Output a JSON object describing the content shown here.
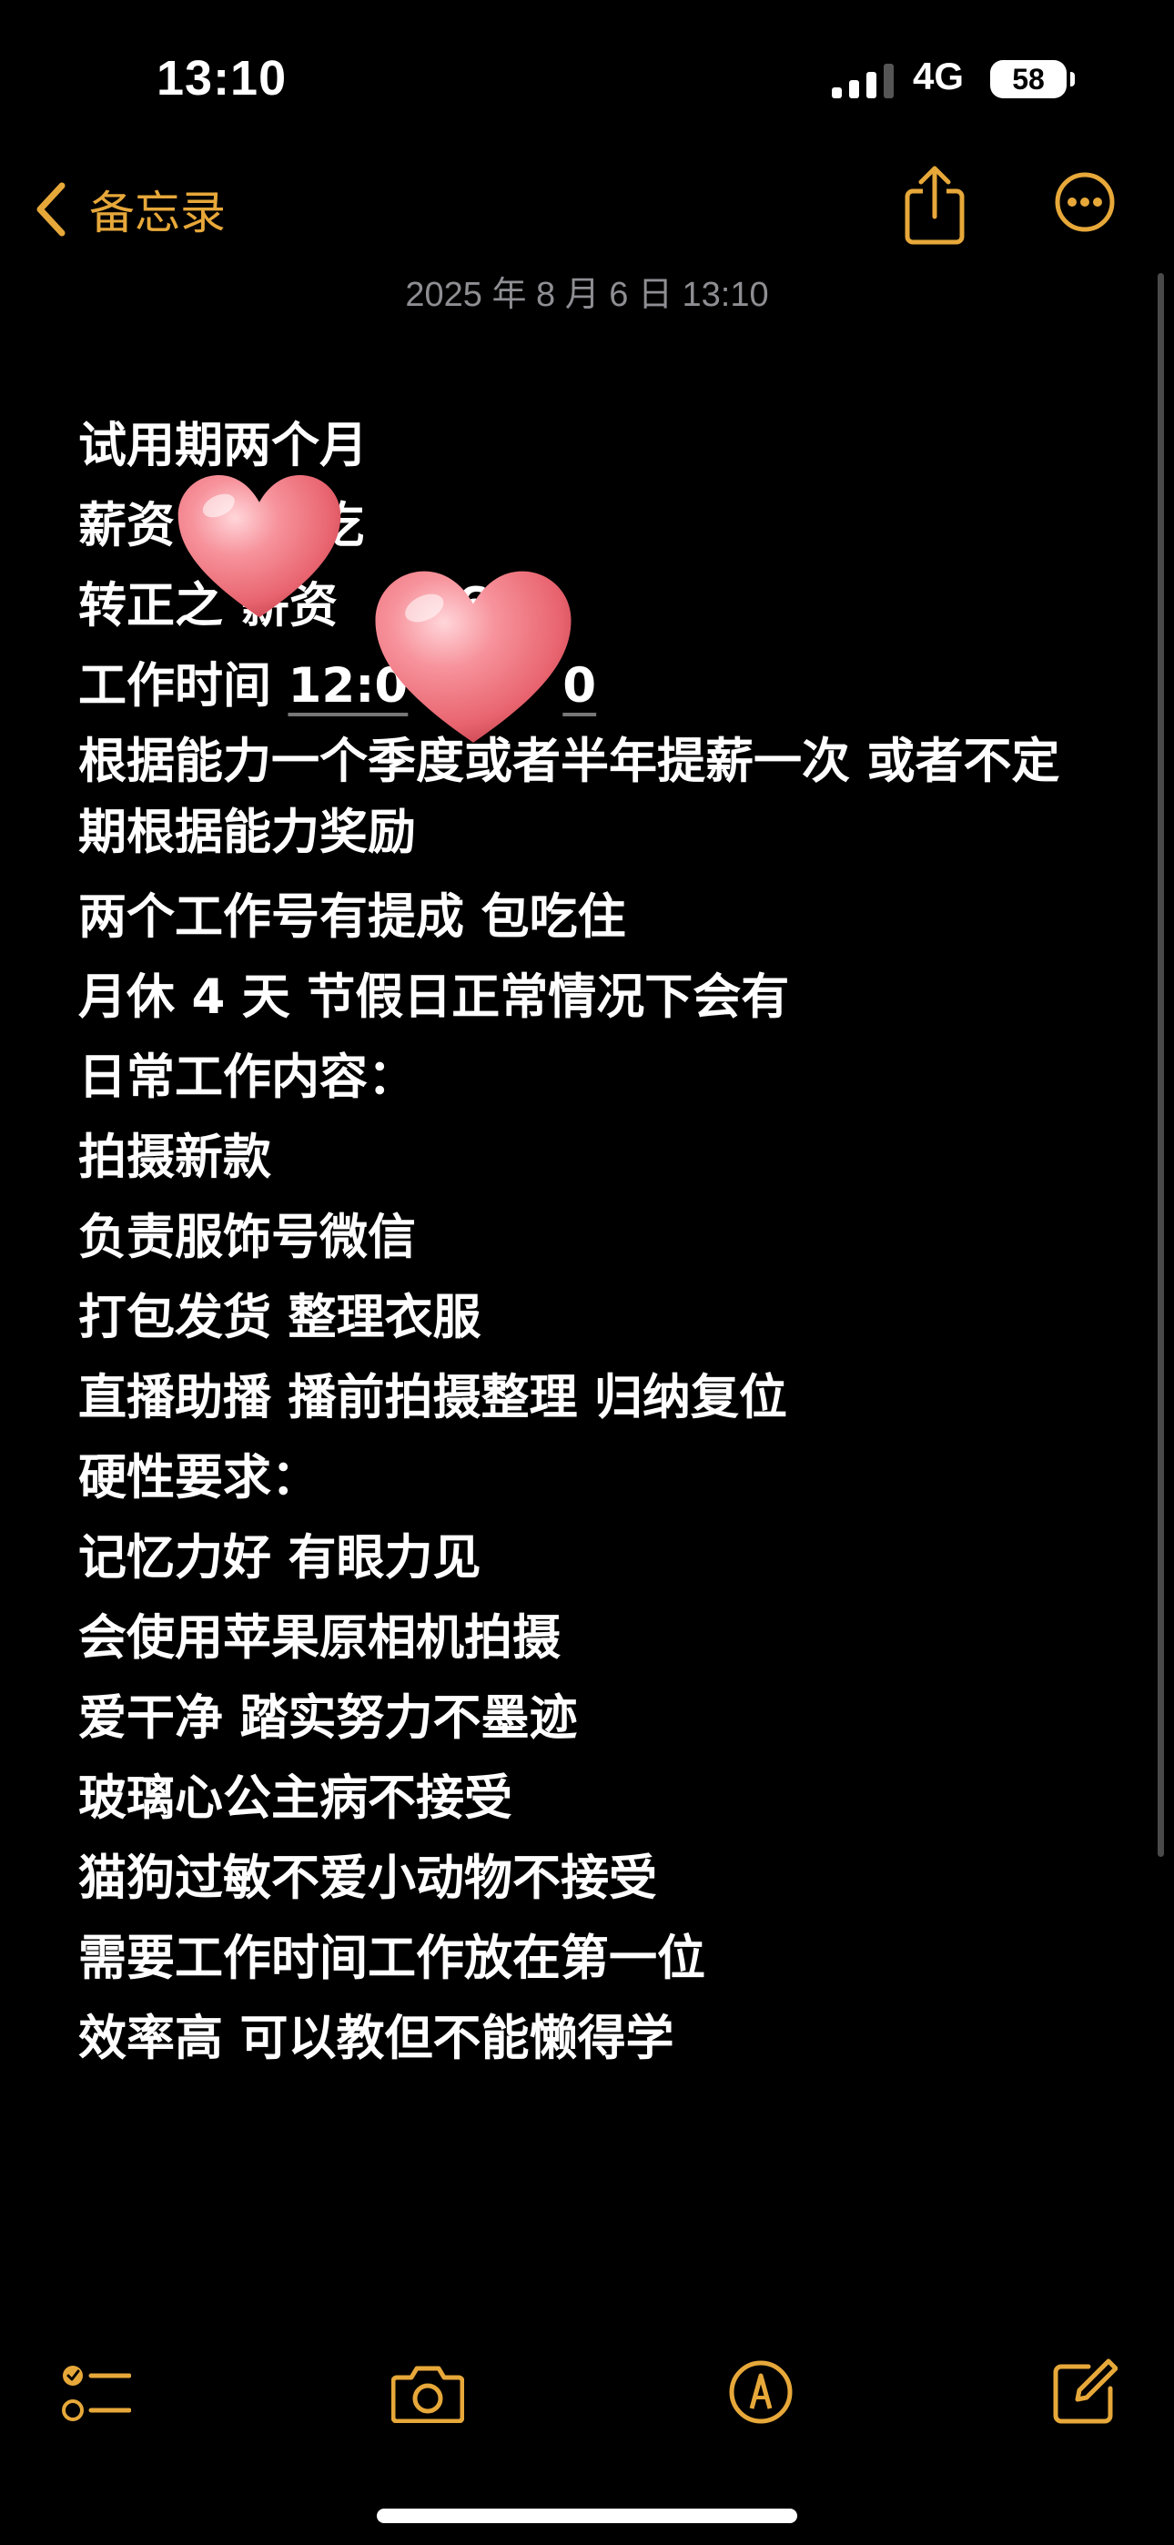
{
  "status_bar": {
    "time": "13:10",
    "network": "4G",
    "battery": "58"
  },
  "nav": {
    "back_label": "备忘录",
    "back_icon": "chevron-left-icon",
    "share_icon": "share-icon",
    "more_icon": "ellipsis-circle-icon",
    "accent_color": "#E7A83A"
  },
  "note": {
    "date": "2025 年 8 月 6 日 13:10",
    "lines": {
      "l1": "试用期两个月",
      "l2a": "薪资",
      "l2b": "吃",
      "l3a": "转正之",
      "l3b": "薪资",
      "l3c": "6k",
      "l4a": "工作时间 ",
      "l4b": "12:0",
      "l4c": "0",
      "l5": "根据能力一个季度或者半年提薪一次 或者不定期根据能力奖励",
      "l6": "两个工作号有提成 包吃住",
      "l7": "月休 4 天 节假日正常情况下会有",
      "l8": "日常工作内容：",
      "l9": "拍摄新款",
      "l10": "负责服饰号微信",
      "l11": "打包发货 整理衣服",
      "l12": "直播助播 播前拍摄整理 归纳复位",
      "l13": "硬性要求：",
      "l14": "记忆力好 有眼力见",
      "l15": "会使用苹果原相机拍摄",
      "l16": "爱干净 踏实努力不墨迹",
      "l17": "玻璃心公主病不接受",
      "l18": "猫狗过敏不爱小动物不接受",
      "l19": "需要工作时间工作放在第一位",
      "l20": "效率高 可以教但不能懒得学"
    }
  },
  "toolbar": {
    "checklist_icon": "checklist-icon",
    "camera_icon": "camera-icon",
    "markup_icon": "markup-pen-icon",
    "compose_icon": "compose-icon"
  }
}
